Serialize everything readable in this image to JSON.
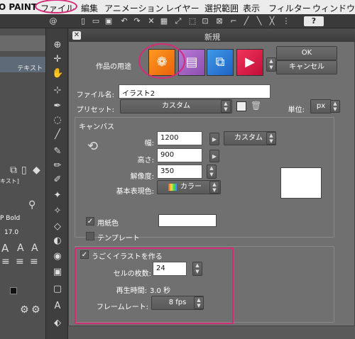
{
  "menubar": {
    "app": "O PAINT",
    "items": [
      "ファイル",
      "編集",
      "アニメーション",
      "レイヤー",
      "選択範囲",
      "表示",
      "フィルター",
      "ウィンドウ"
    ]
  },
  "left_panel": {
    "tab_text": "テキスト",
    "tab_text2": "キスト]",
    "font_name": "P Bold",
    "font_size": "17.0"
  },
  "dialog": {
    "title": "新規",
    "usage_label": "作品の用途",
    "ok": "OK",
    "cancel": "キャンセル",
    "filename_label": "ファイル名:",
    "filename_value": "イラスト2",
    "preset_label": "プリセット:",
    "preset_value": "カスタム",
    "unit_label": "単位:",
    "unit_value": "px",
    "canvas_group": "キャンバス",
    "width_label": "幅:",
    "width_value": "1200",
    "height_label": "高さ:",
    "height_value": "900",
    "size_preset": "カスタム",
    "resolution_label": "解像度:",
    "resolution_value": "350",
    "color_label": "基本表現色:",
    "color_value": "カラー",
    "paper_label": "用紙色",
    "template_label": "テンプレート",
    "anim_label": "うごくイラストを作る",
    "cells_label": "セルの枚数:",
    "cells_value": "24",
    "playtime_label": "再生時間:",
    "playtime_value": "3.0 秒",
    "framerate_label": "フレームレート:",
    "framerate_value": "8 fps"
  },
  "colors": {
    "highlight": "#d52b78",
    "dialog_bg": "#707070",
    "illust_icon": "#ff9a1f",
    "comic_icon": "#b77ad6",
    "web_icon": "#3f9ae8",
    "anim_icon": "#f1345a"
  }
}
